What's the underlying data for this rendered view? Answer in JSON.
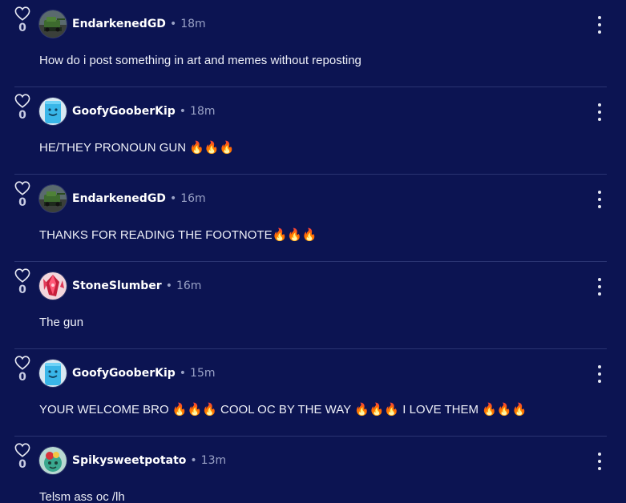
{
  "colors": {
    "background": "#0c1452",
    "divider": "#2a3472",
    "meta": "#9aa2c6",
    "text": "#eef0f8"
  },
  "icons": {
    "like": "heart-outline-icon",
    "menu": "vertical-dots-icon"
  },
  "comments": [
    {
      "likes": "0",
      "user": "EndarkenedGD",
      "separator": "•",
      "time": "18m",
      "text": "How do i post something in art and memes without reposting",
      "avatar": "green-vehicle"
    },
    {
      "likes": "0",
      "user": "GoofyGooberKip",
      "separator": "•",
      "time": "18m",
      "text": "HE/THEY PRONOUN GUN 🔥🔥🔥",
      "avatar": "blue-character"
    },
    {
      "likes": "0",
      "user": "EndarkenedGD",
      "separator": "•",
      "time": "16m",
      "text": "THANKS FOR READING THE FOOTNOTE🔥🔥🔥",
      "avatar": "green-vehicle"
    },
    {
      "likes": "0",
      "user": "StoneSlumber",
      "separator": "•",
      "time": "16m",
      "text": "The gun",
      "avatar": "red-crystal"
    },
    {
      "likes": "0",
      "user": "GoofyGooberKip",
      "separator": "•",
      "time": "15m",
      "text": "YOUR WELCOME BRO 🔥🔥🔥 COOL OC BY THE WAY 🔥🔥🔥 I LOVE THEM 🔥🔥🔥",
      "avatar": "blue-character"
    },
    {
      "likes": "0",
      "user": "Spikysweetpotato",
      "separator": "•",
      "time": "13m",
      "text": "Telsm ass oc /lh",
      "avatar": "teal-creature"
    }
  ]
}
